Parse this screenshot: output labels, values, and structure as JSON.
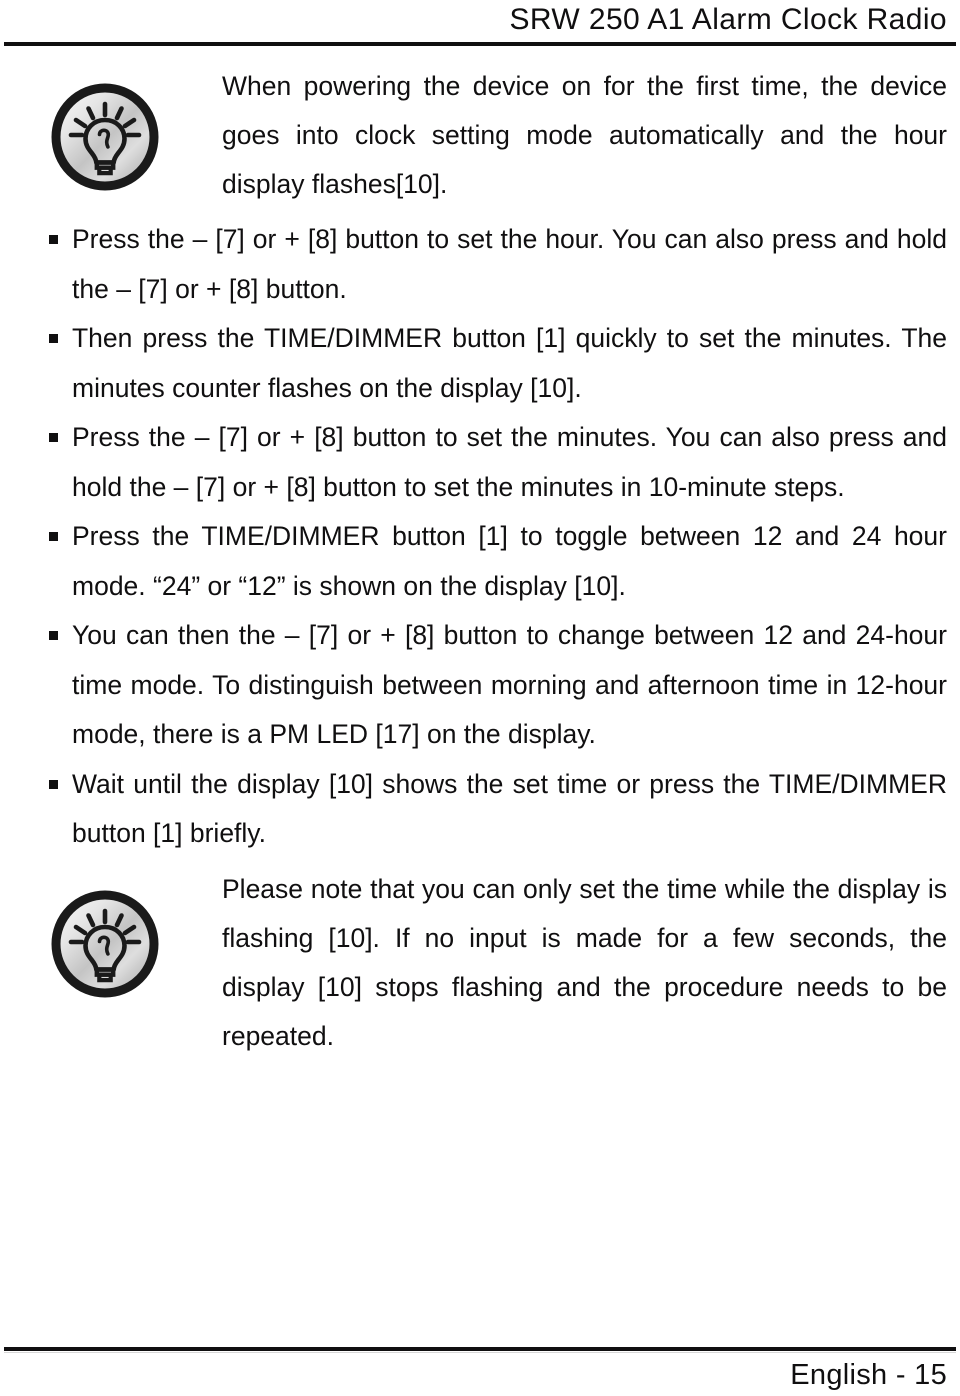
{
  "header": {
    "title": "SRW 250 A1 Alarm Clock Radio"
  },
  "footer": {
    "text": "English - 15"
  },
  "colors": {
    "text": "#100f10",
    "rule": "#100f10",
    "badge_ring": "#1a1a1a",
    "badge_fill_light": "#f2f2f2",
    "badge_fill_mid": "#bdbdbd",
    "badge_fill_dark": "#9a9a9a"
  },
  "icons": {
    "note_badge": "lightbulb-icon",
    "bullet": "square-bullet-icon"
  },
  "notes": [
    {
      "id": "note-first-power-on",
      "text": "When powering the device on for the first time, the device goes into clock setting mode automatically and the hour display flashes[10]."
    },
    {
      "id": "note-flashing-timeout",
      "text": "Please note that you can only set the time while the display is flashing [10]. If no input is made for a few seconds, the display [10] stops flashing and the procedure needs to be repeated."
    }
  ],
  "bullets": [
    {
      "id": "bullet-set-hour",
      "text": "Press the – [7] or + [8] button to set the hour. You can also press and hold the – [7] or + [8] button."
    },
    {
      "id": "bullet-time-dimmer-minutes",
      "text": "Then press the TIME/DIMMER button [1] quickly to set the minutes. The minutes counter flashes on the display [10]."
    },
    {
      "id": "bullet-set-minutes",
      "text": "Press the – [7] or + [8] button to set the minutes. You can also press and hold the – [7] or + [8] button to set the minutes in 10-minute steps."
    },
    {
      "id": "bullet-toggle-12-24",
      "text": "Press the TIME/DIMMER button [1] to toggle between 12 and 24 hour mode. “24” or “12” is shown on the display [10]."
    },
    {
      "id": "bullet-change-12-24-mode",
      "text": "You can then the – [7] or + [8] button to change between 12 and 24-hour time mode. To distinguish between morning and afternoon time in 12-hour mode, there is a PM LED [17] on the display."
    },
    {
      "id": "bullet-wait-or-press",
      "text": "Wait until the display [10] shows the set time or press the TIME/DIMMER button [1] briefly."
    }
  ]
}
